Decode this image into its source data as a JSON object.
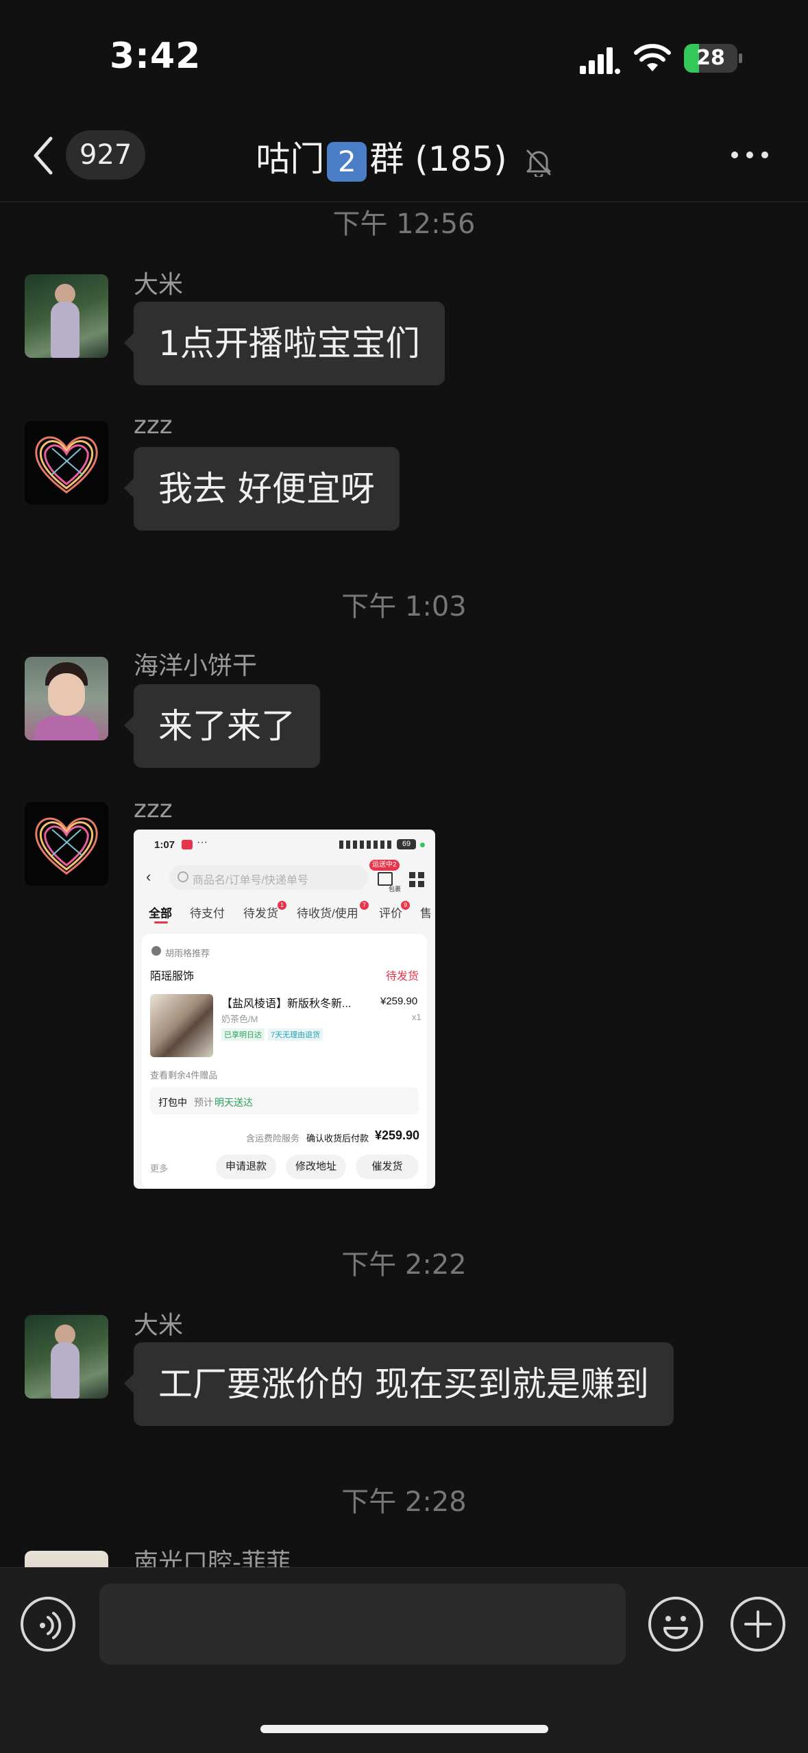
{
  "status_bar": {
    "time": "3:42",
    "battery": "28",
    "battery_level": 0.28
  },
  "nav": {
    "back_icon": "chevron-left-icon",
    "unread_count": "927",
    "title_prefix": "咕门",
    "title_badge": "2",
    "title_suffix": "群 (185)",
    "mute_icon": "bell-slash-icon",
    "more_icon": "ellipsis-icon"
  },
  "chat": {
    "stamps": [
      "下午 12:56",
      "下午 1:03",
      "下午 2:22",
      "下午 2:28"
    ],
    "messages": [
      {
        "sender": "大米",
        "text": "1点开播啦宝宝们"
      },
      {
        "sender": "zzz",
        "text": "我去 好便宜呀"
      },
      {
        "sender": "海洋小饼干",
        "text": "来了来了"
      },
      {
        "sender": "zzz",
        "type": "image"
      },
      {
        "sender": "大米",
        "text": "工厂要涨价的 现在买到就是赚到"
      },
      {
        "sender": "南光口腔-菲菲"
      }
    ]
  },
  "screenshot": {
    "time": "1:07",
    "battery": "69",
    "search_placeholder": "商品名/订单号/快递单号",
    "pkg_badge": "运送中2",
    "pkg_label": "包裹",
    "tabs": [
      "全部",
      "待支付",
      "待发货",
      "待收货/使用",
      "评价",
      "售"
    ],
    "tab_badges": [
      "1",
      "7",
      "9"
    ],
    "recommender": "胡雨格推荐",
    "shop": "陌瑶服饰",
    "order_status": "待发货",
    "product_title": "【盐风棱语】新版秋冬新...",
    "price": "¥259.90",
    "variant": "奶茶色/M",
    "qty": "x1",
    "tag1": "已享明日达",
    "tag2": "7天无理由退货",
    "gifts": "查看剩余4件赠品",
    "packing": "打包中",
    "eta_prefix": "预计",
    "eta": "明天送达",
    "service": "含运费险服务",
    "pay_label": "确认收货后付款",
    "total": "¥259.90",
    "more": "更多",
    "btn_refund": "申请退款",
    "btn_address": "修改地址",
    "btn_urge": "催发货"
  },
  "input": {
    "placeholder": ""
  },
  "bottom_icons": [
    "voice-icon",
    "emoji-icon",
    "plus-icon"
  ],
  "colors": {
    "background": "#111111",
    "bubble": "#2f2f2f",
    "accent_red": "#e8344a",
    "green": "#34c759"
  }
}
